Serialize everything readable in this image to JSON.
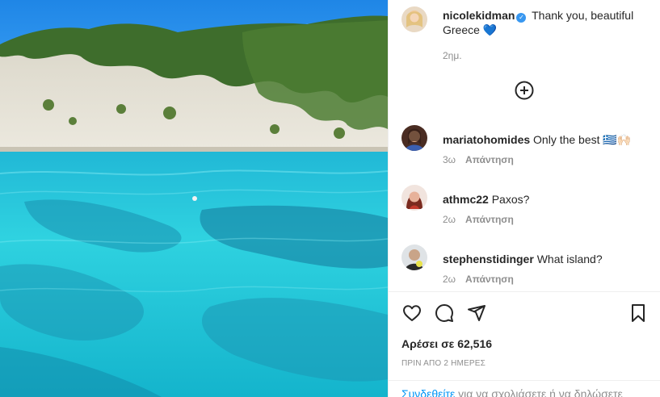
{
  "post": {
    "author": "nicolekidman",
    "caption": "Thank you, beautiful Greece",
    "caption_emoji": "💙",
    "time_ago": "2ημ."
  },
  "comments": [
    {
      "username": "mariatohomides",
      "text": "Only the best",
      "emoji": "🇬🇷🙌🏻",
      "time": "3ω",
      "reply_label": "Απάντηση"
    },
    {
      "username": "athmc22",
      "text": "Paxos?",
      "time": "2ω",
      "reply_label": "Απάντηση"
    },
    {
      "username": "stephenstidinger",
      "text": "What island?",
      "time": "2ω",
      "reply_label": "Απάντηση"
    }
  ],
  "likes_text": "Αρέσει σε 62,516",
  "timestamp_text": "ΠΡΙΝ ΑΠΟ 2 ΗΜΕΡΕΣ",
  "login": {
    "link_text": "Συνδεθείτε",
    "rest_text": " για να σχολιάσετε ή να δηλώσετε"
  },
  "icons": [
    "verified-badge-icon",
    "load-more-comments-icon",
    "heart-icon",
    "comment-icon",
    "share-icon",
    "bookmark-icon"
  ],
  "colors": {
    "link": "#0095f6",
    "verified": "#3897f0",
    "muted": "#8e8e8e",
    "text": "#262626"
  }
}
